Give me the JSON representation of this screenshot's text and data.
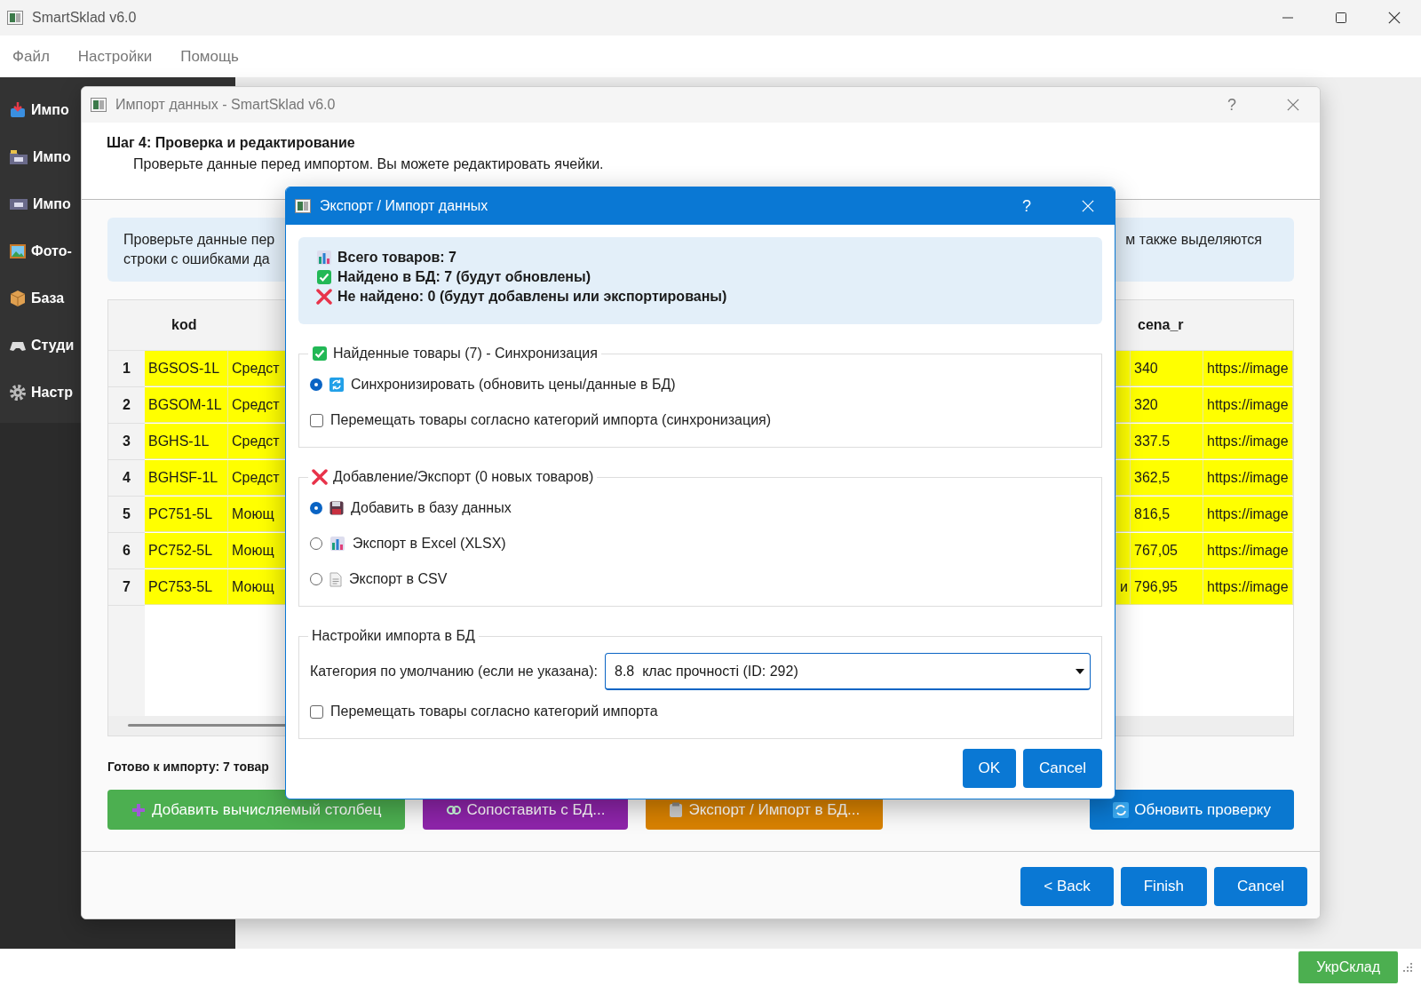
{
  "window": {
    "title": "SmartSklad v6.0"
  },
  "menu": [
    "Файл",
    "Настройки",
    "Помощь"
  ],
  "sidebar": {
    "items": [
      {
        "label": "Импо"
      },
      {
        "label": "Импо"
      },
      {
        "label": "Импо"
      },
      {
        "label": "Фото-"
      },
      {
        "label": "База"
      },
      {
        "label": "Студи"
      },
      {
        "label": "Настр"
      }
    ]
  },
  "wizard": {
    "title": "Импорт данных - SmartSklad v6.0",
    "help": "?",
    "step_title": "Шаг 4: Проверка и редактирование",
    "step_subtitle": "Проверьте данные перед импортом. Вы можете редактировать ячейки.",
    "info_left": [
      "Проверьте данные пер",
      "строки с ошибками да"
    ],
    "info_right": "м также выделяются",
    "table": {
      "columns": [
        "kod",
        "cena_r"
      ],
      "rows": [
        {
          "number": "1",
          "highlighted": true,
          "kod": "BGSOS-1L",
          "column_3": "Средст",
          "cena_r": "340",
          "column_6": "https://image"
        },
        {
          "number": "2",
          "highlighted": true,
          "kod": "BGSOM-1L",
          "column_3": "Средст",
          "cena_r": "320",
          "column_6": "https://image"
        },
        {
          "number": "3",
          "highlighted": true,
          "kod": "BGHS-1L",
          "column_3": "Средст",
          "cena_r": "337.5",
          "column_6": "https://image"
        },
        {
          "number": "4",
          "highlighted": true,
          "kod": "BGHSF-1L",
          "column_3": "Средст",
          "cena_r": "362,5",
          "column_6": "https://image"
        },
        {
          "number": "5",
          "highlighted": true,
          "kod": "PC751-5L",
          "column_3": "Моющ",
          "cena_r": "816,5",
          "column_6": "https://image"
        },
        {
          "number": "6",
          "highlighted": true,
          "kod": "PC752-5L",
          "column_3": "Моющ",
          "cena_r": "767,05",
          "column_6": "https://image"
        },
        {
          "number": "7",
          "highlighted": true,
          "kod": "PC753-5L",
          "column_3": "Моющ",
          "column_4": "и",
          "cena_r": "796,95",
          "column_6": "https://image"
        }
      ]
    },
    "status": "Готово к импорту: 7 товар",
    "actions": [
      {
        "label": "Добавить вычисляемый столбец",
        "color": "#4caf50"
      },
      {
        "label": "Сопоставить с БД...",
        "color": "#8e24aa"
      },
      {
        "label": "Экспорт / Импорт в БД...",
        "color": "#d98200"
      },
      {
        "label": "Обновить проверку",
        "color": "#0a78d0"
      }
    ],
    "footer_buttons": [
      "< Back",
      "Finish",
      "Cancel"
    ]
  },
  "dialog": {
    "title": "Экспорт / Импорт данных",
    "help": "?",
    "summary": [
      "Всего товаров: 7",
      "Найдено в БД: 7 (будут обновлены)",
      "Не найдено: 0 (будут добавлены или экспортированы)"
    ],
    "groups": [
      {
        "title": "Найденные товары (7) - Синхронизация",
        "items": [
          {
            "kind": "radio",
            "label": "Синхронизировать (обновить цены/данные в БД)",
            "selected": true
          },
          {
            "kind": "checkbox",
            "label": "Перемещать товары согласно категорий импорта (синхронизация)",
            "checked": false
          }
        ]
      },
      {
        "title": "Добавление/Экспорт (0 новых товаров)",
        "items": [
          {
            "kind": "radio",
            "label": "Добавить в базу данных",
            "selected": true
          },
          {
            "kind": "radio",
            "label": "Экспорт в Excel (XLSX)",
            "selected": false
          },
          {
            "kind": "radio",
            "label": "Экспорт в CSV",
            "selected": false
          }
        ]
      },
      {
        "title": "Настройки импорта в БД",
        "items": [
          {
            "kind": "combo",
            "label": "Категория по умолчанию (если не указана):",
            "value": "8.8  клас прочності (ID: 292)"
          },
          {
            "kind": "checkbox",
            "label": "Перемещать товары согласно категорий импорта",
            "checked": false
          }
        ]
      }
    ],
    "buttons": [
      "OK",
      "Cancel"
    ]
  },
  "status_bar": {
    "button": "УкрСклад"
  }
}
